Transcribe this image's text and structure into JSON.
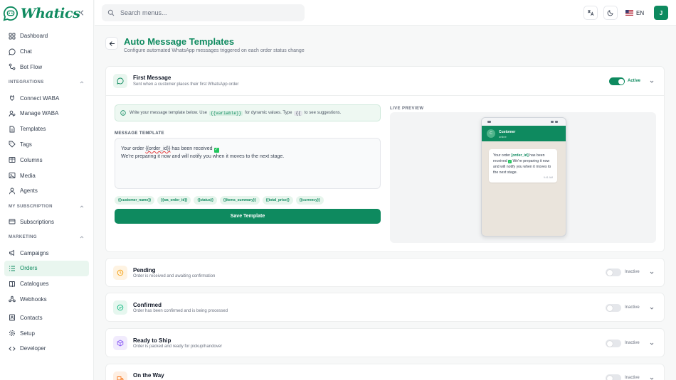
{
  "brand": {
    "name": "Whatics"
  },
  "search": {
    "placeholder": "Search menus..."
  },
  "topbar": {
    "language": "EN",
    "avatar_initial": "J"
  },
  "sidebar": {
    "items_top": [
      {
        "label": "Dashboard",
        "icon": "grid-icon"
      },
      {
        "label": "Chat",
        "icon": "chat-bubble-icon"
      },
      {
        "label": "Bot Flow",
        "icon": "flow-icon"
      }
    ],
    "section_integrations": "INTEGRATIONS",
    "items_integrations": [
      {
        "label": "Connect WABA",
        "icon": "plug-icon"
      },
      {
        "label": "Manage WABA",
        "icon": "users-gear-icon"
      },
      {
        "label": "Templates",
        "icon": "file-icon"
      },
      {
        "label": "Tags",
        "icon": "tag-icon"
      },
      {
        "label": "Columns",
        "icon": "columns-icon"
      },
      {
        "label": "Media",
        "icon": "image-icon"
      },
      {
        "label": "Agents",
        "icon": "user-icon"
      }
    ],
    "section_subscription": "MY SUBSCRIPTION",
    "items_subscription": [
      {
        "label": "Subscriptions",
        "icon": "card-icon"
      }
    ],
    "section_marketing": "MARKETING",
    "items_marketing": [
      {
        "label": "Campaigns",
        "icon": "megaphone-icon"
      },
      {
        "label": "Orders",
        "icon": "list-icon",
        "active": true
      },
      {
        "label": "Catalogues",
        "icon": "book-icon"
      },
      {
        "label": "Webhooks",
        "icon": "webhook-icon"
      }
    ],
    "items_bottom": [
      {
        "label": "Contacts",
        "icon": "contact-icon"
      },
      {
        "label": "Setup",
        "icon": "gear-icon"
      },
      {
        "label": "Developer",
        "icon": "code-icon"
      }
    ]
  },
  "page": {
    "title": "Auto Message Templates",
    "subtitle": "Configure automated WhatsApp messages triggered on each order status change"
  },
  "first": {
    "title": "First Message",
    "desc": "Sent when a customer places their first WhatsApp order",
    "toggle_label": "Active",
    "hint_prefix": "Write your message template below. Use",
    "hint_code": "{{variable}}",
    "hint_middle": "for dynamic values. Type",
    "hint_key": "{{",
    "hint_suffix": "to see suggestions.",
    "field_label": "MESSAGE TEMPLATE",
    "editor_line1_a": "Your order ",
    "editor_var": "{{order_id}}",
    "editor_line1_b": " has been received ",
    "editor_line2": "We're preparing it now and will notify you when it moves to the next stage.",
    "chips": [
      "{{customer_name}}",
      "{{wa_order_id}}",
      "{{status}}",
      "{{items_summary}}",
      "{{total_price}}",
      "{{currency}}"
    ],
    "save_label": "Save Template",
    "preview_label": "LIVE PREVIEW",
    "preview": {
      "contact": "Customer",
      "contact_state": "online",
      "avatar": "C",
      "msg_a": "Your order ",
      "msg_b": "[order_id]",
      "msg_c": " has been received ",
      "msg_d": " We're preparing it now and will notify you when it moves to the next stage.",
      "time": "9:41 AM"
    }
  },
  "statuses": [
    {
      "title": "Pending",
      "desc": "Order is received and awaiting confirmation",
      "toggle": "Inactive",
      "icon": "clock-icon",
      "color": "#f59e0b",
      "bg": "#fef3e2"
    },
    {
      "title": "Confirmed",
      "desc": "Order has been confirmed and is being processed",
      "toggle": "Inactive",
      "icon": "check-circle-icon",
      "color": "#10b981",
      "bg": "#e6f7ef"
    },
    {
      "title": "Ready to Ship",
      "desc": "Order is packed and ready for pickup/handover",
      "toggle": "Inactive",
      "icon": "package-icon",
      "color": "#8b5cf6",
      "bg": "#f1ebfd"
    },
    {
      "title": "On the Way",
      "desc": "",
      "toggle": "Inactive",
      "icon": "truck-icon",
      "color": "#f97316",
      "bg": "#feefe3"
    }
  ],
  "colors": {
    "brand": "#0e8a5f",
    "active_nav_bg": "#e9f6ef"
  }
}
